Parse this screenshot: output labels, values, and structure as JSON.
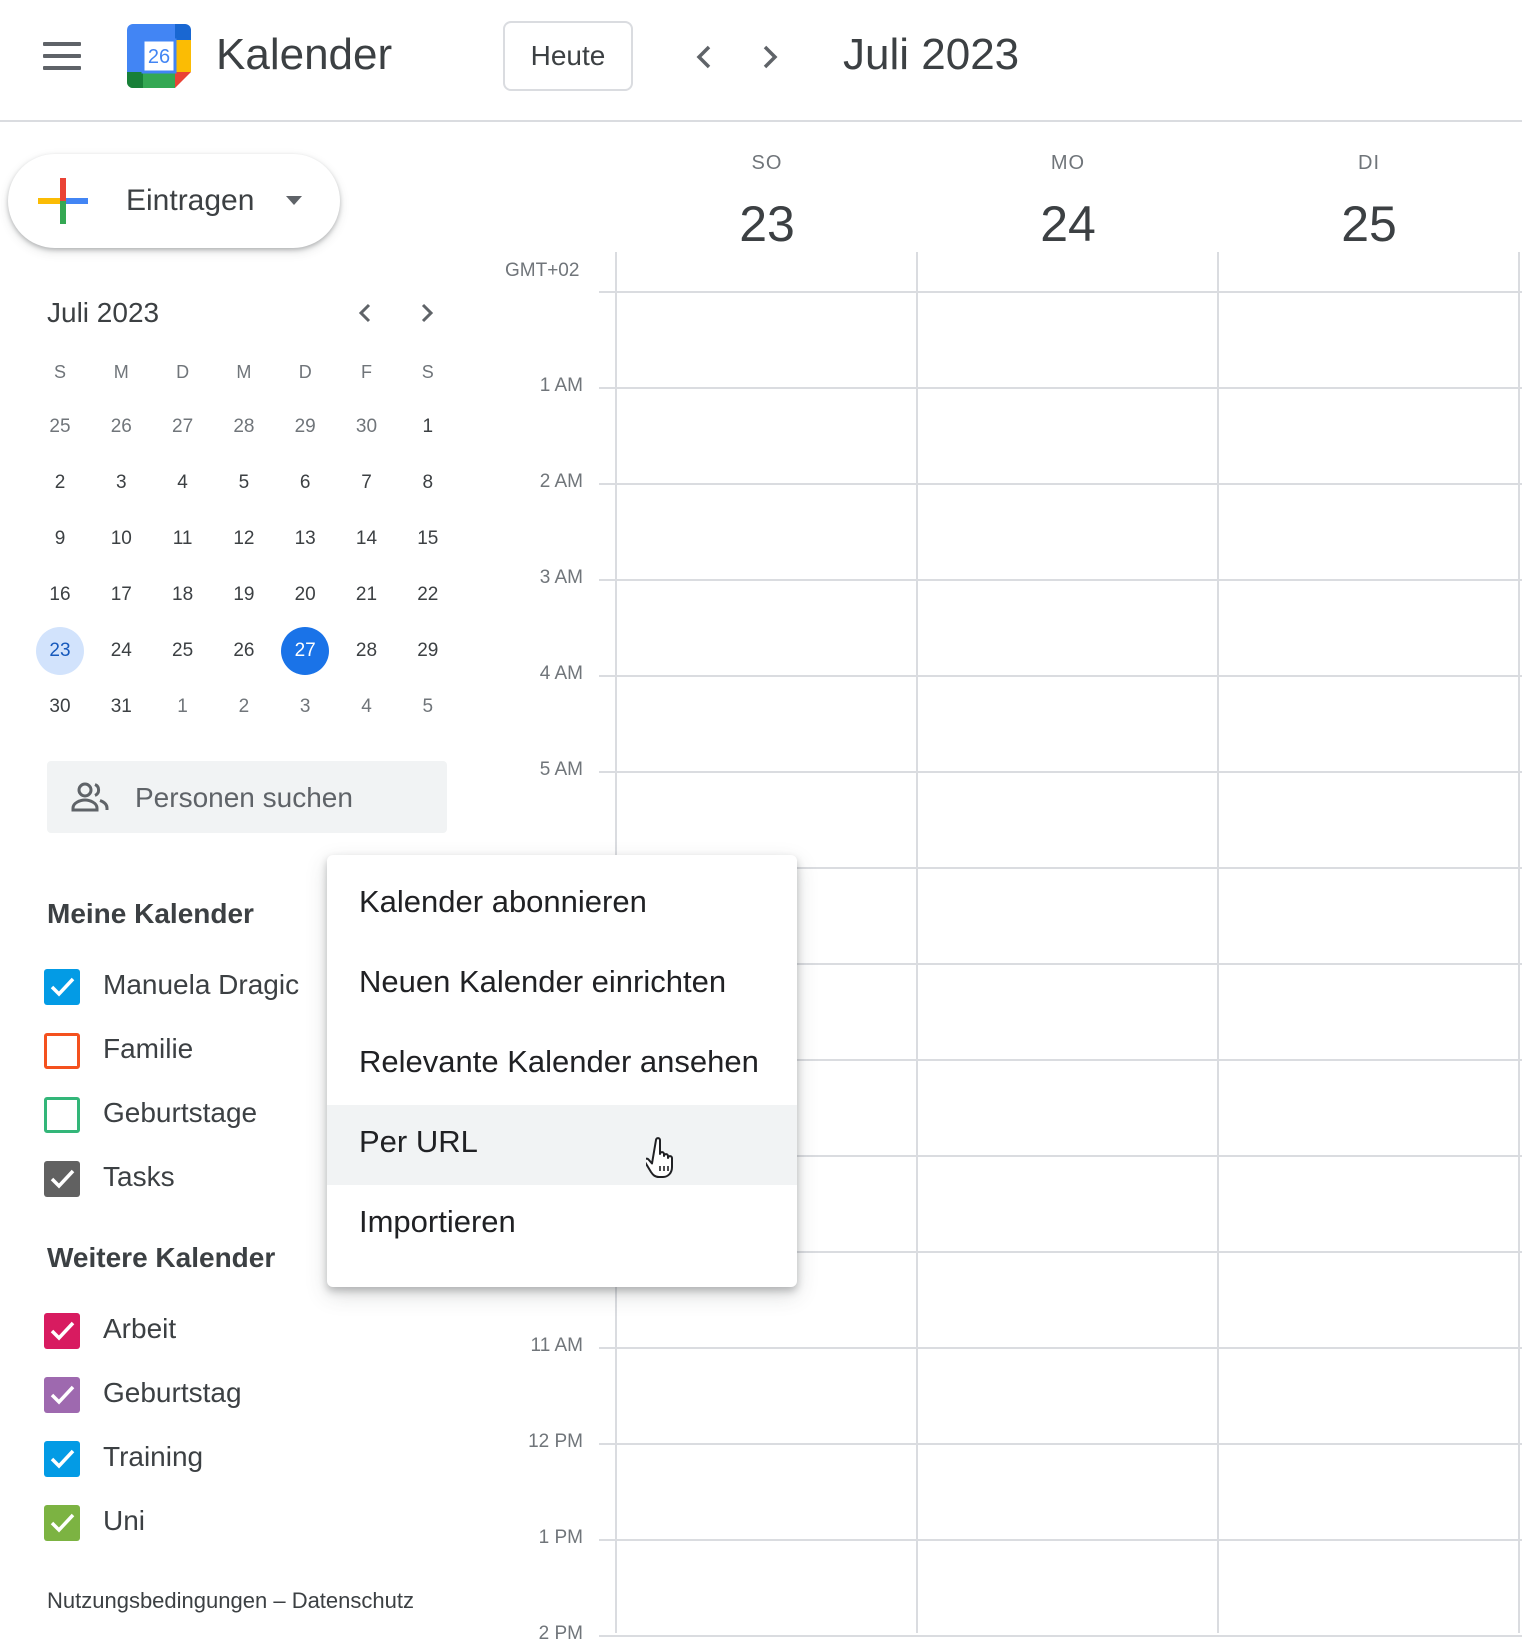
{
  "header": {
    "app_title": "Kalender",
    "logo_day": "26",
    "today_label": "Heute",
    "current_period": "Juli 2023"
  },
  "create_button": {
    "label": "Eintragen"
  },
  "mini_calendar": {
    "title": "Juli 2023",
    "weekday_headers": [
      "S",
      "M",
      "D",
      "M",
      "D",
      "F",
      "S"
    ],
    "weeks": [
      [
        "25",
        "26",
        "27",
        "28",
        "29",
        "30",
        "1"
      ],
      [
        "2",
        "3",
        "4",
        "5",
        "6",
        "7",
        "8"
      ],
      [
        "9",
        "10",
        "11",
        "12",
        "13",
        "14",
        "15"
      ],
      [
        "16",
        "17",
        "18",
        "19",
        "20",
        "21",
        "22"
      ],
      [
        "23",
        "24",
        "25",
        "26",
        "27",
        "28",
        "29"
      ],
      [
        "30",
        "31",
        "1",
        "2",
        "3",
        "4",
        "5"
      ]
    ],
    "today": "27",
    "selected": "23"
  },
  "people_search": {
    "placeholder": "Personen suchen"
  },
  "my_calendars": {
    "title": "Meine Kalender",
    "items": [
      {
        "label": "Manuela Dragic",
        "checked": true,
        "color": "#039be5"
      },
      {
        "label": "Familie",
        "checked": false,
        "color": "#f4511e"
      },
      {
        "label": "Geburtstage",
        "checked": false,
        "color": "#33b679"
      },
      {
        "label": "Tasks",
        "checked": true,
        "color": "#616161"
      }
    ]
  },
  "other_calendars": {
    "title": "Weitere Kalender",
    "items": [
      {
        "label": "Arbeit",
        "checked": true,
        "color": "#d81b60"
      },
      {
        "label": "Geburtstag",
        "checked": true,
        "color": "#9e69af"
      },
      {
        "label": "Training",
        "checked": true,
        "color": "#039be5"
      },
      {
        "label": "Uni",
        "checked": true,
        "color": "#7cb342"
      }
    ]
  },
  "footer": {
    "terms": "Nutzungsbedingungen",
    "separator": "–",
    "privacy": "Datenschutz"
  },
  "grid": {
    "timezone": "GMT+02",
    "days": [
      {
        "name": "SO",
        "number": "23"
      },
      {
        "name": "MO",
        "number": "24"
      },
      {
        "name": "DI",
        "number": "25"
      }
    ],
    "hours": [
      "1 AM",
      "2 AM",
      "3 AM",
      "4 AM",
      "5 AM",
      "11 AM",
      "12 PM",
      "1 PM",
      "2 PM"
    ]
  },
  "add_calendar_menu": {
    "items": [
      "Kalender abonnieren",
      "Neuen Kalender einrichten",
      "Relevante Kalender ansehen",
      "Per URL",
      "Importieren"
    ],
    "hovered": "Per URL"
  },
  "colors": {
    "accent": "#1a73e8",
    "selected_bg": "#d2e3fc",
    "grid_line": "#dadce0"
  }
}
